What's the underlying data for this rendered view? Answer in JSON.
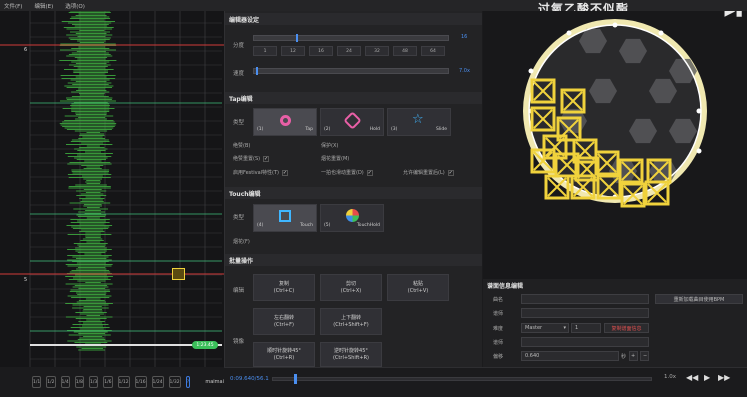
{
  "menu": {
    "file": "文件(F)",
    "edit": "编辑(E)",
    "options": "选项(O)"
  },
  "title_overlay": "过氧乙酸不似酯",
  "timeline": {
    "marker_top": "6",
    "marker_mid": "5",
    "time_badge": "1:23.45"
  },
  "timeline_tools": [
    "1/1",
    "1/2",
    "1/4",
    "1/8",
    "1/3",
    "1/6",
    "1/12",
    "1/16",
    "1/24",
    "1/32"
  ],
  "timeline_active_tool": "?",
  "timeline_logo": "maimai",
  "editor": {
    "section_editor": "编辑器设定",
    "division_label": "分度",
    "division_ticks": [
      "1",
      "12",
      "16",
      "24",
      "32",
      "48",
      "64"
    ],
    "division_value": "16",
    "speed_label": "速度",
    "speed_value": "7.0x",
    "section_tap": "Tap编辑",
    "type_label": "类型",
    "tap_types": [
      {
        "key": "(1)",
        "name": "Tap"
      },
      {
        "key": "(2)",
        "name": "Hold"
      },
      {
        "key": "(3)",
        "name": "Slide"
      }
    ],
    "checks": [
      {
        "label": "绝赞(B)",
        "checked": false
      },
      {
        "label": "保护(X)",
        "checked": false
      },
      {
        "label": "绝赞重置(S)",
        "checked": true
      },
      {
        "label": "烟花重置(M)",
        "checked": false
      },
      {
        "label": "启用Festival特性(T)",
        "checked": true
      },
      {
        "label": "一拍也滑动重置(D)",
        "checked": true
      },
      {
        "label": "允许编辑重置后(L)",
        "checked": true
      }
    ],
    "section_touch": "Touch编辑",
    "touch_type_label": "类型",
    "touch_types": [
      {
        "key": "(4)",
        "name": "Touch"
      },
      {
        "key": "(5)",
        "name": "TouchHold"
      }
    ],
    "touch_check": "烟花(F)",
    "section_batch": "批量操作",
    "batch_edit_label": "编辑",
    "batch_flip_label": "镜像",
    "batch_buttons": {
      "copy": "复制\n(Ctrl+C)",
      "cut": "剪切\n(Ctrl+X)",
      "paste": "粘贴\n(Ctrl+V)",
      "flip_lr": "左右翻转\n(Ctrl+F)",
      "flip_ud": "上下翻转\n(Ctrl+Shift+F)",
      "rot_cw": "顺时针旋转45°\n(Ctrl+R)",
      "rot_ccw": "逆时针旋转45°\n(Ctrl+Shift+R)"
    }
  },
  "chart_info": {
    "title": "谱面信息编辑",
    "artist_label": "曲名",
    "author_label": "谱师",
    "difficulty_label": "难度",
    "level_label": "谱师",
    "offset_label": "偏移",
    "difficulty_value": "Master",
    "level_value": "1",
    "offset_value": "0.640",
    "offset_unit": "秒",
    "refresh_button": "重新加载曲目使用BPM",
    "copy_button": "复制谱面信息"
  },
  "playback": {
    "time": "0:09.640/56.1",
    "speed": "1.0x"
  },
  "colors": {
    "accent": "#4b8ff0",
    "wave": "#3fae3f",
    "note_yellow": "#f0d23c",
    "red_line": "#d13a3a"
  }
}
